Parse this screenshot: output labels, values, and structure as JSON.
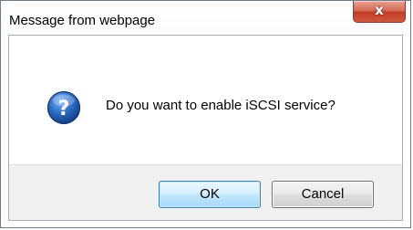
{
  "dialog": {
    "title": "Message from webpage",
    "close_glyph": "x",
    "icon": "question-icon",
    "message": "Do you want to enable iSCSI service?",
    "ok_label": "OK",
    "cancel_label": "Cancel"
  },
  "colors": {
    "close_button": "#c74a32",
    "icon_blue": "#1f5fb5",
    "default_button_border": "#3c7fb1",
    "button_strip": "#f0f0f0"
  }
}
